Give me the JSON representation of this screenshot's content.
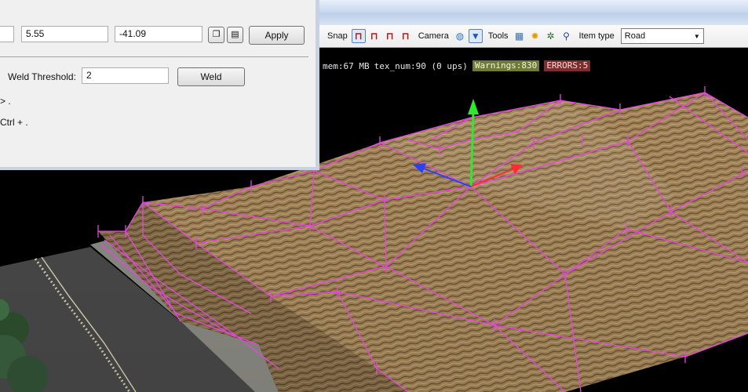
{
  "panel": {
    "coord_y": "5.55",
    "coord_z": "-41.09",
    "copy_icon": "copy-icon",
    "paste_icon": "paste-icon",
    "apply_label": "Apply",
    "weld_label": "Weld Threshold:",
    "weld_value": "2",
    "weld_button": "Weld",
    "hint_1": "> .",
    "hint_2": "Ctrl + ."
  },
  "toolbar": {
    "snap_label": "Snap",
    "snap_icons": [
      "magnet-icon",
      "magnet-plus-icon",
      "magnet-icon",
      "magnet-minus-icon"
    ],
    "camera_label": "Camera",
    "camera_icons": [
      "globe-icon",
      "camera-target-icon"
    ],
    "tools_label": "Tools",
    "tools_icons": [
      "grid-icon",
      "sun-icon",
      "gear-icon",
      "magnifier-icon"
    ],
    "item_type_label": "Item type",
    "item_type_value": "Road"
  },
  "stats": {
    "mem": "mem:67 MB",
    "tex": "tex_num:90 (0 ups)",
    "warnings": "Warnings:830",
    "errors": "ERRORS:5"
  },
  "colors": {
    "wireframe": "#e545e0",
    "gizmo_x": "#ff2d2d",
    "gizmo_y": "#2ee82e",
    "gizmo_z": "#2840ff",
    "terrain": "#a88a5e",
    "road": "#4b4b4b"
  }
}
